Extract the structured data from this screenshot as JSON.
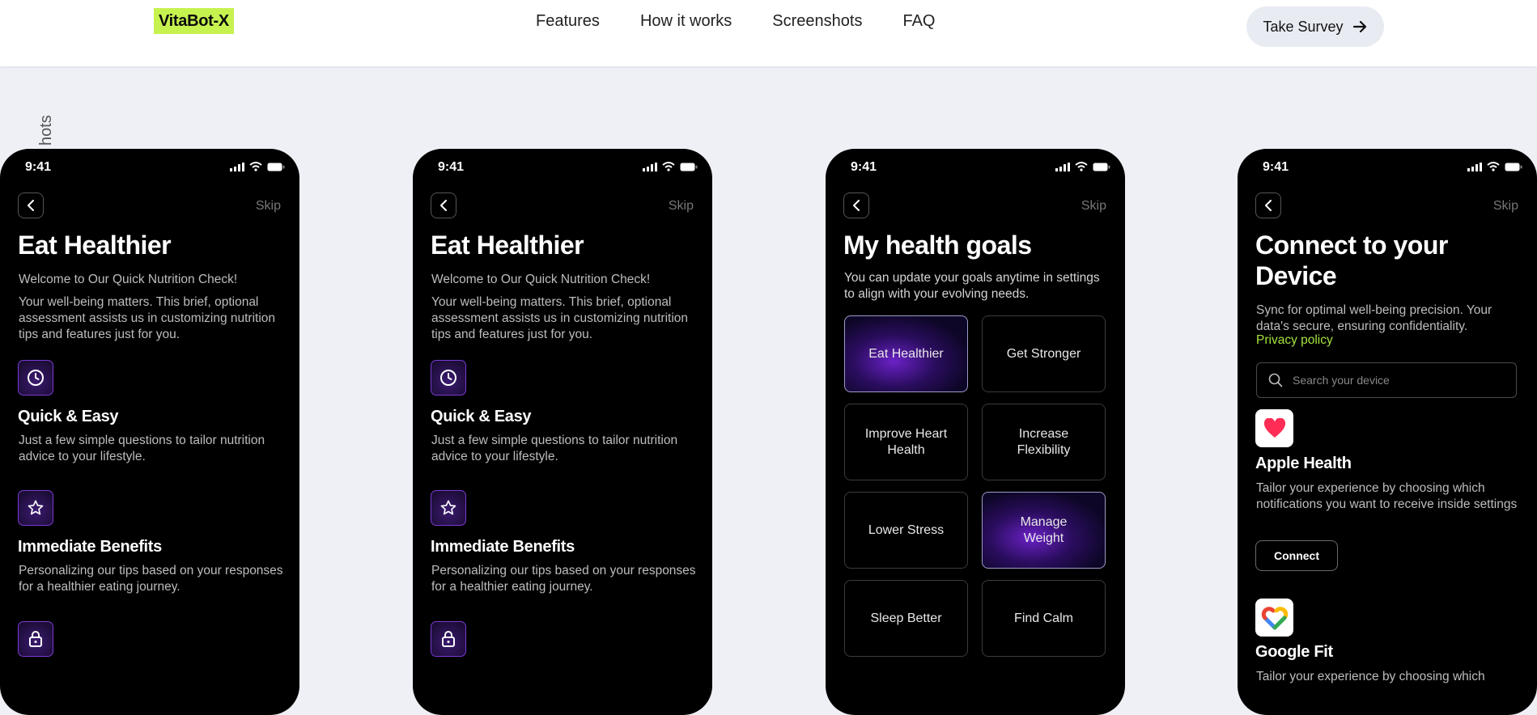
{
  "nav": {
    "logo": "VitaBot-X",
    "links": [
      "Features",
      "How it works",
      "Screenshots",
      "FAQ"
    ],
    "cta": "Take Survey"
  },
  "section_label": "hots",
  "status_time": "9:41",
  "phones": [
    {
      "back_icon": "chevron-left-icon",
      "skip": "Skip",
      "title": "Eat Healthier",
      "intro": "Welcome to Our Quick Nutrition Check!",
      "body": "Your well-being matters. This brief, optional assessment assists us in customizing nutrition tips and features just for you.",
      "features": [
        {
          "icon": "clock-icon",
          "title": "Quick & Easy",
          "desc": "Just a few simple questions to tailor nutrition advice to your lifestyle."
        },
        {
          "icon": "star-icon",
          "title": "Immediate Benefits",
          "desc": "Personalizing our tips based on your responses for a healthier eating journey."
        },
        {
          "icon": "lock-icon"
        }
      ]
    },
    {
      "back_icon": "chevron-left-icon",
      "skip": "Skip",
      "title": "Eat Healthier",
      "intro": "Welcome to Our Quick Nutrition Check!",
      "body": "Your well-being matters. This brief, optional assessment assists us in customizing nutrition tips and features just for you.",
      "features": [
        {
          "icon": "clock-icon",
          "title": "Quick & Easy",
          "desc": "Just a few simple questions to tailor nutrition advice to your lifestyle."
        },
        {
          "icon": "star-icon",
          "title": "Immediate Benefits",
          "desc": "Personalizing our tips based on your responses for a healthier eating journey."
        },
        {
          "icon": "lock-icon"
        }
      ]
    },
    {
      "skip": "Skip",
      "title": "My health goals",
      "subtitle": "You can update your goals anytime in settings to align with your evolving needs.",
      "goals": [
        {
          "label": "Eat Healthier",
          "selected": true
        },
        {
          "label": "Get Stronger",
          "selected": false
        },
        {
          "label": "Improve Heart Health",
          "selected": false
        },
        {
          "label": "Increase Flexibility",
          "selected": false
        },
        {
          "label": "Lower Stress",
          "selected": false
        },
        {
          "label": "Manage Weight",
          "selected": true
        },
        {
          "label": "Sleep Better",
          "selected": false
        },
        {
          "label": "Find Calm",
          "selected": false
        }
      ]
    },
    {
      "skip": "Skip",
      "title": "Connect to your Device",
      "desc": "Sync for optimal well-being precision. Your data's secure, ensuring confidentiality.",
      "privacy": "Privacy policy",
      "search_placeholder": "Search your device",
      "apps": [
        {
          "name": "Apple Health",
          "icon": "heart-icon",
          "desc": "Tailor your experience by choosing which notifications you want to receive inside settings",
          "button": "Connect"
        },
        {
          "name": "Google Fit",
          "icon": "google-fit-icon",
          "desc": "Tailor your experience by choosing which"
        }
      ]
    }
  ],
  "colors": {
    "accent": "#c6f24f",
    "link": "#a6e33e",
    "purple": "#7b3bd4"
  }
}
